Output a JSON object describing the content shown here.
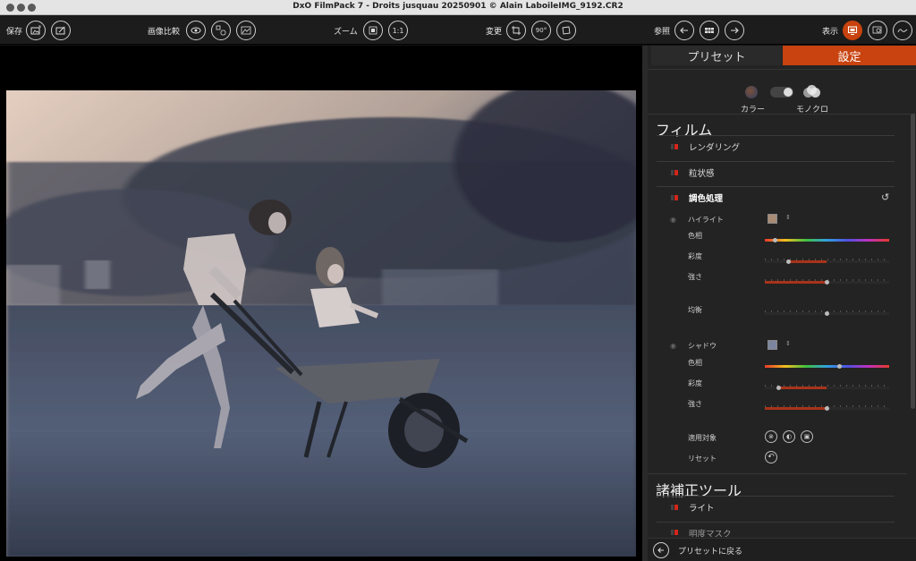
{
  "window": {
    "title": "DxO FilmPack 7 - Droits jusquau 20250901 © Alain LaboileIMG_9192.CR2"
  },
  "toolbar": {
    "save_label": "保存",
    "compare_label": "画像比較",
    "zoom_label": "ズーム",
    "zoom_1to1": "1:1",
    "transform_label": "変更",
    "rotate_90": "90°",
    "browse_label": "参照",
    "display_label": "表示"
  },
  "panel": {
    "tab_presets": "プリセット",
    "tab_settings": "設定",
    "mode_color": "カラー",
    "mode_mono": "モノクロ",
    "film_section": "フィルム",
    "rendering": "レンダリング",
    "grain": "粒状感",
    "toning": "調色処理",
    "highlight_label": "ハイライト",
    "hue_label": "色相",
    "saturation_label": "彩度",
    "strength_label": "強さ",
    "balance_label": "均衡",
    "shadow_label": "シャドウ",
    "apply_to_label": "適用対象",
    "reset_label": "リセット",
    "corrections_section": "諸補正ツール",
    "light": "ライト",
    "lens_mask_partial": "明度マスク",
    "back_to_presets": "プリセットに戻る"
  },
  "values": {
    "highlight_hue": 0.08,
    "highlight_saturation": 0.19,
    "highlight_strength": 0.5,
    "highlight_balance": 0.5,
    "shadow_hue": 0.6,
    "shadow_saturation": 0.11,
    "shadow_strength": 0.5
  },
  "colors": {
    "accent": "#c8430f",
    "highlight_swatch": "#a88b74",
    "shadow_swatch": "#7d86a0",
    "indicator_red": "#d3261a"
  }
}
